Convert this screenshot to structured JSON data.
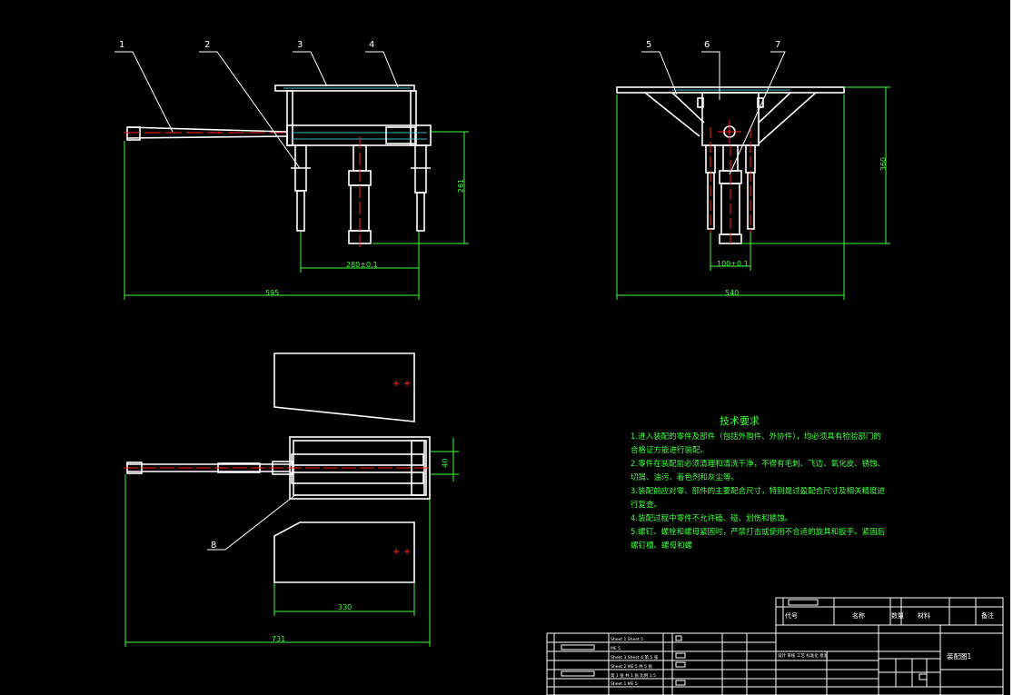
{
  "drawing": {
    "colors": {
      "background": "#000000",
      "outline": "#ffffff",
      "dimension": "#3cff3c",
      "centerline": "#ff2020",
      "hatch": "#39b6c4"
    },
    "part_numbers": [
      "1",
      "2",
      "3",
      "4",
      "5",
      "6",
      "7",
      "8"
    ],
    "dimensions": {
      "front_width": "595",
      "front_height": "261",
      "front_spacing": "280±0.1",
      "side_width": "540",
      "side_height": "360",
      "side_spacing": "100±0.1",
      "top_width": "731",
      "top_inner": "330",
      "top_small": "40"
    },
    "technical_requirements": {
      "title": "技术要求",
      "lines": [
        "1.进入装配的零件及部件（包括外购件、外协件），均必须具有检验部门的",
        "合格证方能进行装配。",
        "2.零件在装配前必须清理和清洗干净，不得有毛刺、飞边、氧化皮、锈蚀、",
        "切屑、油污、着色剂和灰尘等。",
        "3.装配前应对零、部件的主要配合尺寸，特别是过盈配合尺寸及相关精度进",
        "行复查。",
        "4.装配过程中零件不允许磕、碰、划伤和锈蚀。",
        "5.螺钉、螺栓和螺母紧固时，严禁打击或使用不合适的旋具和扳手。紧固后",
        "螺钉槽、螺母和螺"
      ]
    },
    "title_block": {
      "col_code": "代号",
      "col_name": "名称",
      "col_qty": "数量",
      "col_material": "材料",
      "col_remark": "备注",
      "drawing_name": "装配图1",
      "row_1": "Sheet 1 Sheet 5",
      "row_2": "ME 5",
      "row_3": "Sheet 3 Sheet 4 第 5 张",
      "row_4": "Sheet 2 ME 5 共 5 张",
      "row_5": "第 1 张 共 1 张 比例 1:5",
      "row_6": "Sheet 1 ME 5",
      "row_7": "设计 审核 工艺 标准化 批准"
    }
  }
}
